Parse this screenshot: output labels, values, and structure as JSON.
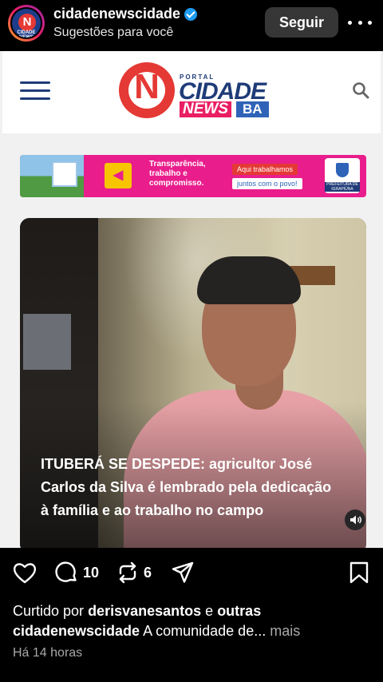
{
  "header": {
    "username": "cidadenewscidade",
    "subtitle": "Sugestões para você",
    "follow_label": "Seguir",
    "avatar_logo_letter": "N",
    "avatar_logo_text": "CIDADE NEWS"
  },
  "site": {
    "logo_letter": "N",
    "logo_portal": "PORTAL",
    "logo_cidade": "CIDADE",
    "logo_news": "NEWS",
    "logo_ba": "BA"
  },
  "banner": {
    "slogan": "Transparência, trabalho e compromisso.",
    "pill_top": "Aqui trabalhamos",
    "pill_bottom": "juntos com o povo!",
    "seal_caption": "PREFEITURA DE IGRAPIÚNA"
  },
  "post": {
    "headline": "ITUBERÁ SE DESPEDE: agricultor José Carlos da Silva é lembrado pela dedicação à família e ao trabalho no campo"
  },
  "actions": {
    "comments_count": "10",
    "reposts_count": "6"
  },
  "likes": {
    "prefix": "Curtido por",
    "user": "derisvanesantos",
    "connector": "e",
    "others": "outras"
  },
  "caption": {
    "user": "cidadenewscidade",
    "text": "A comunidade de...",
    "more": "mais"
  },
  "timestamp": "Há 14 horas",
  "colors": {
    "brand_red": "#e53935",
    "brand_blue": "#1f3b78",
    "brand_pink": "#e91e63",
    "verified_blue": "#1d9bf0"
  },
  "icons": [
    "verified-icon",
    "more-options-icon",
    "menu-icon",
    "search-icon",
    "megaphone-icon",
    "sound-icon",
    "heart-icon",
    "comment-icon",
    "repost-icon",
    "share-icon",
    "bookmark-icon"
  ]
}
